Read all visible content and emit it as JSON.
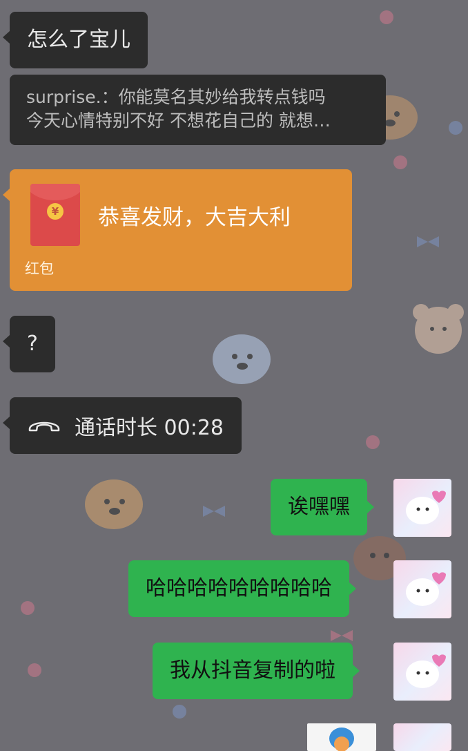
{
  "messages": {
    "incoming_1": "怎么了宝儿",
    "quote": {
      "line1": "surprise.：你能莫名其妙给我转点钱吗",
      "line2": "今天心情特别不好 不想花自己的 就想…"
    },
    "red_packet": {
      "coin_symbol": "¥",
      "title": "恭喜发财，大吉大利",
      "label": "红包"
    },
    "incoming_2": "?",
    "call": {
      "text": "通话时长 00:28",
      "icon": "phone-hangup-icon"
    },
    "outgoing_1": "诶嘿嘿",
    "outgoing_2": "哈哈哈哈哈哈哈哈哈",
    "outgoing_3": "我从抖音复制的啦"
  },
  "avatars": {
    "self": "puppy-avatar",
    "other": "cartoon-avatar"
  },
  "colors": {
    "dark_bubble": "#2c2c2c",
    "green_bubble": "#2fb34f",
    "red_packet": "#e29035",
    "background": "#6e6d73"
  }
}
